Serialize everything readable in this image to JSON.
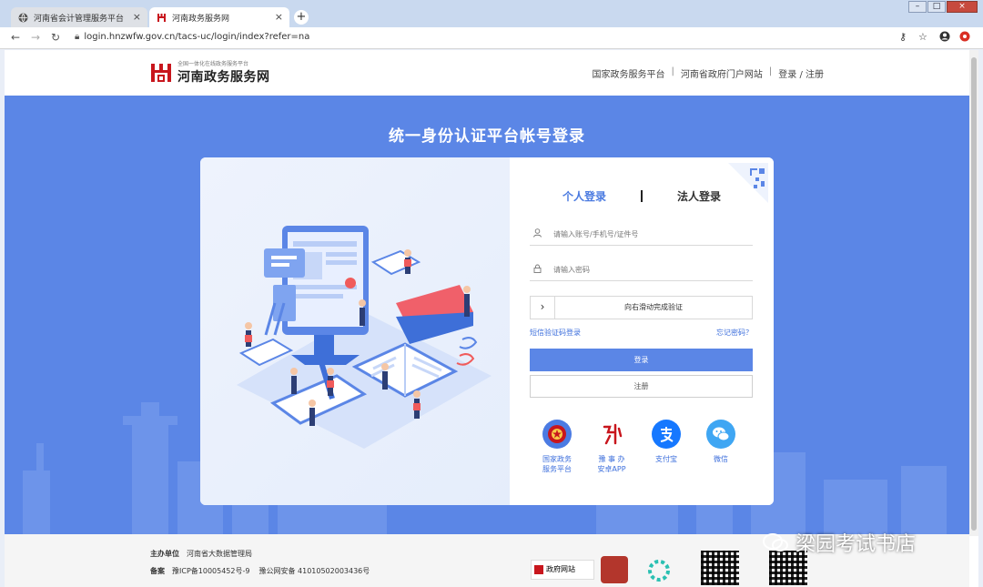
{
  "browser": {
    "tabs": [
      {
        "title": "河南省会计管理服务平台"
      },
      {
        "title": "河南政务服务网"
      }
    ],
    "url": "login.hnzwfw.gov.cn/tacs-uc/login/index?refer=na"
  },
  "header": {
    "logo_slogan": "全国一体化在线政务服务平台",
    "logo_name": "河南政务服务网",
    "nav": [
      "国家政务服务平台",
      "河南省政府门户网站",
      "登录 / 注册"
    ]
  },
  "hero": {
    "title": "统一身份认证平台帐号登录"
  },
  "login": {
    "tab_personal": "个人登录",
    "tab_legal": "法人登录",
    "account_placeholder": "请输入账号/手机号/证件号",
    "password_placeholder": "请输入密码",
    "slider_text": "向右滑动完成验证",
    "sms_login": "短信验证码登录",
    "forgot": "忘记密码？",
    "login_btn": "登录",
    "register_btn": "注册",
    "third_party": [
      {
        "label_1": "国家政务",
        "label_2": "服务平台"
      },
      {
        "label_1": "豫 事 办",
        "label_2": "安卓APP"
      },
      {
        "label_1": "支付宝",
        "label_2": ""
      },
      {
        "label_1": "微信",
        "label_2": ""
      }
    ]
  },
  "footer": {
    "sponsor_label": "主办单位",
    "sponsor": "河南省大数据管理局",
    "record_label": "备案",
    "icp": "豫ICP备10005452号-9",
    "police": "豫公网安备 41010502003436号",
    "gov_site": "政府网站"
  },
  "watermark": "梁园考试书店",
  "colors": {
    "accent": "#5b86e6",
    "link": "#3d6fdc",
    "brand_red": "#c8161d"
  }
}
